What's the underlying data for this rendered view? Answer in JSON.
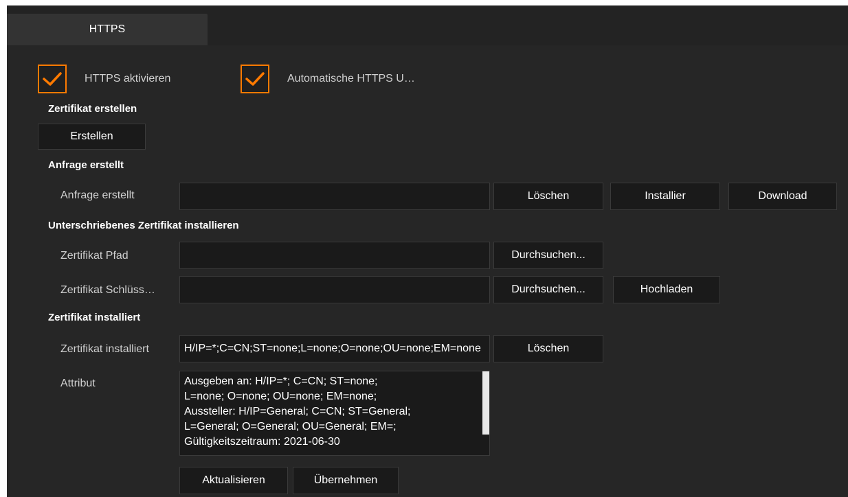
{
  "tabs": [
    {
      "label": "HTTPS"
    }
  ],
  "checkboxes": {
    "enable_https": {
      "label": "HTTPS aktivieren",
      "checked": true
    },
    "auto_redirect": {
      "label": "Automatische HTTPS U…",
      "checked": true
    }
  },
  "create_section": {
    "title": "Zertifikat erstellen",
    "create_button": "Erstellen"
  },
  "request_section": {
    "title": "Anfrage erstellt",
    "field_label": "Anfrage erstellt",
    "field_value": "",
    "delete_button": "Löschen",
    "install_button": "Installier",
    "download_button": "Download"
  },
  "signed_section": {
    "title": "Unterschriebenes Zertifikat installieren",
    "path_label": "Zertifikat Pfad",
    "path_value": "",
    "path_browse": "Durchsuchen...",
    "key_label": "Zertifikat Schlüss…",
    "key_value": "",
    "key_browse": "Durchsuchen...",
    "upload_button": "Hochladen"
  },
  "installed_section": {
    "title": "Zertifikat installiert",
    "field_label": "Zertifikat installiert",
    "field_value": "H/IP=*;C=CN;ST=none;L=none;O=none;OU=none;EM=none",
    "delete_button": "Löschen",
    "attr_label": "Attribut",
    "attr_lines": [
      "Ausgeben an: H/IP=*; C=CN; ST=none;",
      "L=none; O=none; OU=none; EM=none;",
      "Aussteller: H/IP=General; C=CN; ST=General;",
      "L=General; O=General; OU=General; EM=;",
      "Gültigkeitszeitraum: 2021-06-30"
    ]
  },
  "footer": {
    "refresh_button": "Aktualisieren",
    "apply_button": "Übernehmen"
  },
  "colors": {
    "accent": "#ff7a00",
    "background": "#262626",
    "field": "#1a1a1a"
  }
}
